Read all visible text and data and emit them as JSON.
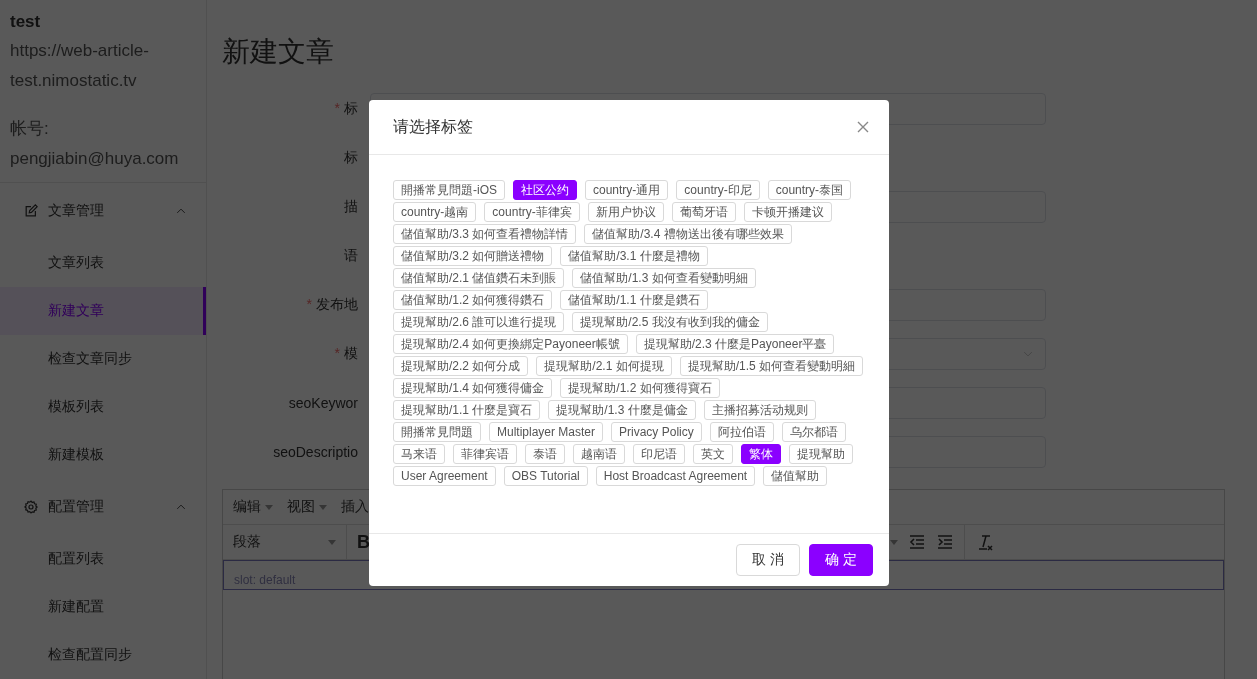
{
  "sidebar": {
    "site": "test",
    "url": "https://web-article-test.nimostatic.tv",
    "account_label": "帐号:",
    "account": "pengjiabin@huya.com",
    "menu": [
      {
        "label": "文章管理",
        "kind": "edit",
        "expanded": true,
        "children": [
          {
            "label": "文章列表",
            "selected": false
          },
          {
            "label": "新建文章",
            "selected": true
          },
          {
            "label": "检查文章同步",
            "selected": false
          },
          {
            "label": "模板列表",
            "selected": false
          },
          {
            "label": "新建模板",
            "selected": false
          }
        ]
      },
      {
        "label": "配置管理",
        "kind": "gear",
        "expanded": true,
        "children": [
          {
            "label": "配置列表",
            "selected": false
          },
          {
            "label": "新建配置",
            "selected": false
          },
          {
            "label": "检查配置同步",
            "selected": false
          }
        ]
      }
    ]
  },
  "page": {
    "title": "新建文章",
    "form": [
      {
        "required_mark": "*",
        "label": "标",
        "kind": "input"
      },
      {
        "label": "标",
        "kind": "none"
      },
      {
        "label": "描",
        "kind": "input"
      },
      {
        "label": "语",
        "kind": "none"
      },
      {
        "required_mark": "*",
        "label": "发布地",
        "kind": "input"
      },
      {
        "required_mark": "*",
        "label": "模",
        "kind": "select"
      },
      {
        "label": "seoKeywor",
        "kind": "input"
      },
      {
        "label": "seoDescriptio",
        "kind": "input"
      }
    ],
    "editor": {
      "menus": [
        "编辑",
        "视图",
        "插入"
      ],
      "block_format": "段落",
      "bold": "B",
      "content": "slot: default"
    }
  },
  "dialog": {
    "title": "请选择标签",
    "tags": [
      {
        "label": "開播常見問題-iOS",
        "selected": false
      },
      {
        "label": "社区公约",
        "selected": true
      },
      {
        "label": "country-通用",
        "selected": false
      },
      {
        "label": "country-印尼",
        "selected": false
      },
      {
        "label": "country-泰国",
        "selected": false
      },
      {
        "label": "country-越南",
        "selected": false
      },
      {
        "label": "country-菲律宾",
        "selected": false
      },
      {
        "label": "新用户协议",
        "selected": false
      },
      {
        "label": "葡萄牙语",
        "selected": false
      },
      {
        "label": "卡顿开播建议",
        "selected": false
      },
      {
        "label": "儲值幫助/3.3 如何查看禮物詳情",
        "selected": false
      },
      {
        "label": "儲值幫助/3.4 禮物送出後有哪些效果",
        "selected": false
      },
      {
        "label": "儲值幫助/3.2 如何贈送禮物",
        "selected": false
      },
      {
        "label": "儲值幫助/3.1 什麼是禮物",
        "selected": false
      },
      {
        "label": "儲值幫助/2.1 儲值鑽石未到賬",
        "selected": false
      },
      {
        "label": "儲值幫助/1.3 如何查看變動明細",
        "selected": false
      },
      {
        "label": "儲值幫助/1.2 如何獲得鑽石",
        "selected": false
      },
      {
        "label": "儲值幫助/1.1 什麼是鑽石",
        "selected": false
      },
      {
        "label": "提現幫助/2.6 誰可以進行提現",
        "selected": false
      },
      {
        "label": "提現幫助/2.5 我沒有收到我的傭金",
        "selected": false
      },
      {
        "label": "提現幫助/2.4 如何更換綁定Payoneer帳號",
        "selected": false
      },
      {
        "label": "提現幫助/2.3 什麼是Payoneer平臺",
        "selected": false
      },
      {
        "label": "提現幫助/2.2 如何分成",
        "selected": false
      },
      {
        "label": "提現幫助/2.1 如何提現",
        "selected": false
      },
      {
        "label": "提現幫助/1.5 如何查看變動明細",
        "selected": false
      },
      {
        "label": "提現幫助/1.4 如何獲得傭金",
        "selected": false
      },
      {
        "label": "提現幫助/1.2 如何獲得寶石",
        "selected": false
      },
      {
        "label": "提現幫助/1.1 什麼是寶石",
        "selected": false
      },
      {
        "label": "提現幫助/1.3 什麼是傭金",
        "selected": false
      },
      {
        "label": "主播招募活动规则",
        "selected": false
      },
      {
        "label": "開播常見問題",
        "selected": false
      },
      {
        "label": "Multiplayer Master",
        "selected": false
      },
      {
        "label": "Privacy Policy",
        "selected": false
      },
      {
        "label": "阿拉伯语",
        "selected": false
      },
      {
        "label": "乌尔都语",
        "selected": false
      },
      {
        "label": "马来语",
        "selected": false
      },
      {
        "label": "菲律宾语",
        "selected": false
      },
      {
        "label": "泰语",
        "selected": false
      },
      {
        "label": "越南语",
        "selected": false
      },
      {
        "label": "印尼语",
        "selected": false
      },
      {
        "label": "英文",
        "selected": false
      },
      {
        "label": "繁体",
        "selected": true
      },
      {
        "label": "提現幫助",
        "selected": false
      },
      {
        "label": "User Agreement",
        "selected": false
      },
      {
        "label": "OBS Tutorial",
        "selected": false
      },
      {
        "label": "Host Broadcast Agreement",
        "selected": false
      },
      {
        "label": "儲值幫助",
        "selected": false
      }
    ],
    "buttons": [
      {
        "label": "取 消",
        "kind": "secondary"
      },
      {
        "label": "确 定",
        "kind": "primary"
      }
    ]
  }
}
